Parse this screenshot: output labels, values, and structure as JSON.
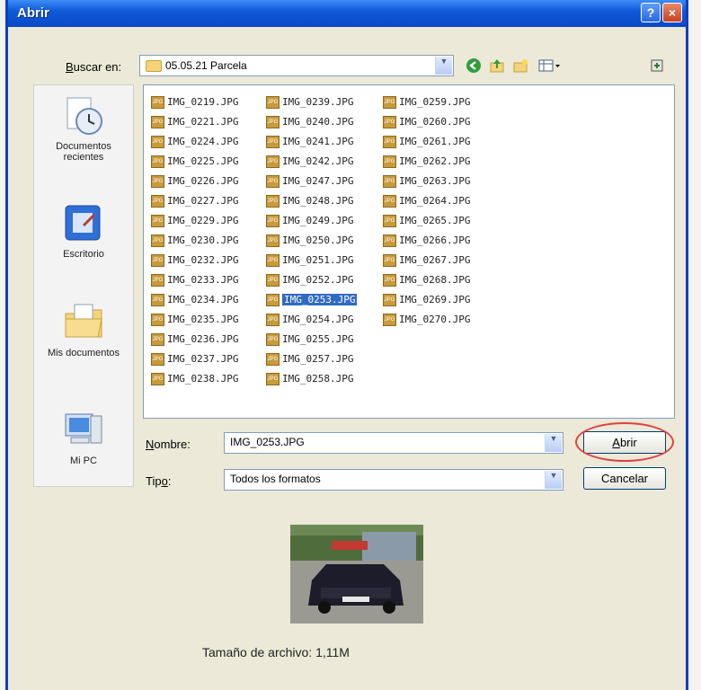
{
  "window": {
    "title": "Abrir",
    "help_glyph": "?",
    "close_glyph": "×"
  },
  "lookin": {
    "label_prefix": "B",
    "label_rest": "uscar en:",
    "value": "05.05.21 Parcela"
  },
  "toolbar": [
    "back-icon",
    "up-folder-icon",
    "new-folder-icon",
    "view-menu-icon"
  ],
  "places": [
    {
      "label": "Documentos recientes",
      "icon": "recent-documents-icon"
    },
    {
      "label": "Escritorio",
      "icon": "desktop-icon"
    },
    {
      "label": "Mis documentos",
      "icon": "my-documents-icon"
    },
    {
      "label": "Mi PC",
      "icon": "my-computer-icon"
    }
  ],
  "files": {
    "col1": [
      "IMG_0219.JPG",
      "IMG_0221.JPG",
      "IMG_0224.JPG",
      "IMG_0225.JPG",
      "IMG_0226.JPG",
      "IMG_0227.JPG",
      "IMG_0229.JPG",
      "IMG_0230.JPG",
      "IMG_0232.JPG",
      "IMG_0233.JPG",
      "IMG_0234.JPG",
      "IMG_0235.JPG",
      "IMG_0236.JPG",
      "IMG_0237.JPG",
      "IMG_0238.JPG"
    ],
    "col2": [
      "IMG_0239.JPG",
      "IMG_0240.JPG",
      "IMG_0241.JPG",
      "IMG_0242.JPG",
      "IMG_0247.JPG",
      "IMG_0248.JPG",
      "IMG_0249.JPG",
      "IMG_0250.JPG",
      "IMG_0251.JPG",
      "IMG_0252.JPG",
      "IMG_0253.JPG",
      "IMG_0254.JPG",
      "IMG_0255.JPG",
      "IMG_0257.JPG",
      "IMG_0258.JPG"
    ],
    "col3": [
      "IMG_0259.JPG",
      "IMG_0260.JPG",
      "IMG_0261.JPG",
      "IMG_0262.JPG",
      "IMG_0263.JPG",
      "IMG_0264.JPG",
      "IMG_0265.JPG",
      "IMG_0266.JPG",
      "IMG_0267.JPG",
      "IMG_0268.JPG",
      "IMG_0269.JPG",
      "IMG_0270.JPG"
    ],
    "selected": "IMG_0253.JPG",
    "icon_text": "JPG"
  },
  "filename": {
    "label_prefix": "N",
    "label_rest": "ombre:",
    "value": "IMG_0253.JPG"
  },
  "filetype": {
    "label_prefix": "Tip",
    "label_u": "o",
    "label_rest": ":",
    "value": "Todos los formatos"
  },
  "buttons": {
    "open_prefix": "A",
    "open_rest": "brir",
    "cancel": "Cancelar"
  },
  "preview": {
    "size_text": "Tamaño de archivo: 1,11M"
  },
  "colors": {
    "title_bar": "#0a49c8",
    "selection": "#316ac5",
    "annotation_ring": "#e04040"
  }
}
